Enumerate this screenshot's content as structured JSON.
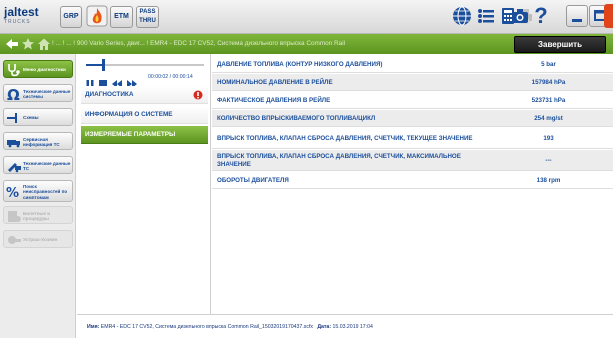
{
  "app": {
    "logo_main": "jaltest",
    "logo_sub": "TRUCKS"
  },
  "toolbar": {
    "grp_label": "GRP",
    "etm_label": "ETM",
    "pass_label_1": "PASS",
    "pass_label_2": "THRU",
    "help_label": "?"
  },
  "colors": {
    "accent_green": "#6aa42c",
    "text_blue": "#1b4f9c",
    "close_red": "#e0441b"
  },
  "nav": {
    "breadcrumb": "! ... ! ... ! 900 Vario Series, двиг... ! EMR4 - EDC 17 CV52, Система дизельного впрыска Common Rail",
    "finish_label": "Завершить"
  },
  "sidebar": {
    "items": [
      {
        "label": "Меню диагностики",
        "icon": "stethoscope-icon"
      },
      {
        "label": "Технические данные системы",
        "icon": "omega-icon"
      },
      {
        "label": "Схемы",
        "icon": "schematic-icon"
      },
      {
        "label": "Сервисная информация ТС",
        "icon": "truck-info-icon"
      },
      {
        "label": "Технические данные ТС",
        "icon": "truck-tech-icon"
      },
      {
        "label": "Поиск неисправностей по симптомам",
        "icon": "percent-search-icon"
      },
      {
        "label": "Билетные и процедуры",
        "icon": "procedures-icon"
      },
      {
        "label": "Устраш-Хозяин",
        "icon": "tools-icon"
      }
    ]
  },
  "player": {
    "time": "00:00:02 / 00:00:14",
    "progress": 0.14
  },
  "menu": {
    "items": [
      {
        "label": "ДИАГНОСТИКА"
      },
      {
        "label": "ИНФОРМАЦИЯ О СИСТЕМЕ"
      },
      {
        "label": "ИЗМЕРЯЕМЫЕ ПАРАМЕТРЫ"
      }
    ]
  },
  "params": {
    "rows": [
      {
        "name": "ДАВЛЕНИЕ ТОПЛИВА (КОНТУР НИЗКОГО ДАВЛЕНИЯ)",
        "value": "5 bar"
      },
      {
        "name": "НОМИНАЛЬНОЕ ДАВЛЕНИЕ В РЕЙЛЕ",
        "value": "157984 hPa"
      },
      {
        "name": "ФАКТИЧЕСКОЕ ДАВЛЕНИЯ В РЕЙЛЕ",
        "value": "523731 hPa"
      },
      {
        "name": "КОЛИЧЕСТВО ВПРЫСКИВАЕМОГО ТОПЛИВА/ЦИКЛ",
        "value": "254 mg/st"
      },
      {
        "name": "ВПРЫСК ТОПЛИВА, КЛАПАН СБРОСА ДАВЛЕНИЯ, СЧЕТЧИК, ТЕКУЩЕЕ ЗНАЧЕНИЕ",
        "value": "193"
      },
      {
        "name": "ВПРЫСК ТОПЛИВА, КЛАПАН СБРОСА ДАВЛЕНИЯ, СЧЕТЧИК, МАКСИМАЛЬНОЕ ЗНАЧЕНИЕ",
        "value": "---"
      },
      {
        "name": "ОБОРОТЫ ДВИГАТЕЛЯ",
        "value": "138 rpm"
      }
    ]
  },
  "footer": {
    "name_label": "Имя:",
    "name_value": "EMR4 - EDC 17 CV52, Система дизельного впрыска Common Rail_15032019170437.scfx",
    "date_label": "Дата:",
    "date_value": "15.03.2019 17:04"
  }
}
